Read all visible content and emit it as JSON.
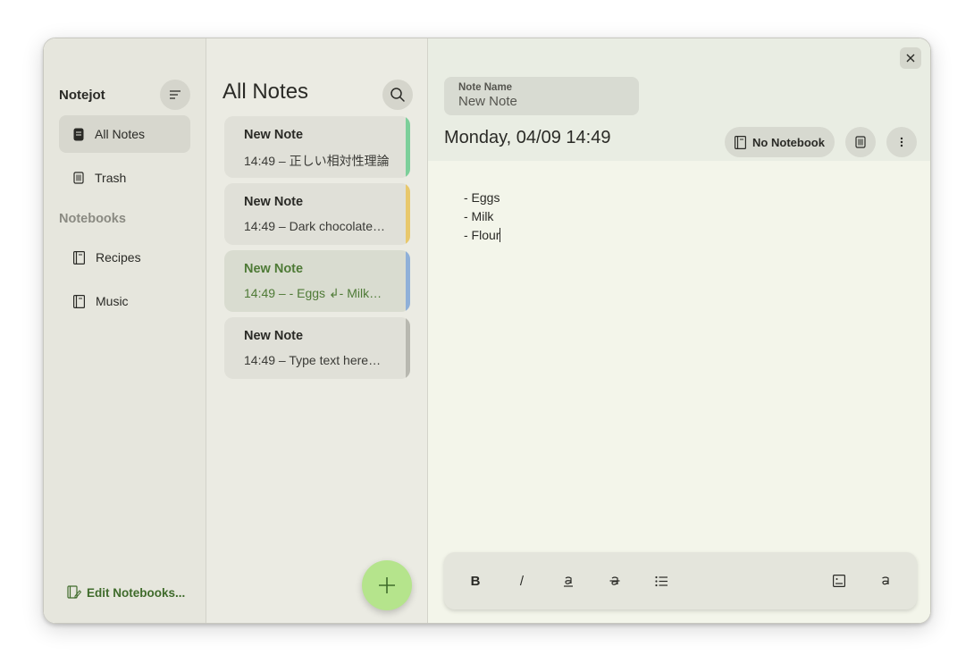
{
  "app": {
    "title": "Notejot"
  },
  "sidebar": {
    "items": [
      {
        "label": "All Notes",
        "icon": "note-icon"
      },
      {
        "label": "Trash",
        "icon": "trash-icon"
      }
    ],
    "notebooks_label": "Notebooks",
    "notebooks": [
      {
        "label": "Recipes",
        "icon": "notebook-icon"
      },
      {
        "label": "Music",
        "icon": "notebook-icon"
      }
    ],
    "edit_notebooks": "Edit Notebooks..."
  },
  "notes_list": {
    "title": "All Notes",
    "notes": [
      {
        "title": "New Note",
        "preview": "14:49 – 正しい相対性理論",
        "color": "#7ccf9a"
      },
      {
        "title": "New Note",
        "preview": "14:49 – Dark chocolate…",
        "color": "#e8c86c"
      },
      {
        "title": "New Note",
        "preview": "14:49 – - Eggs ↲- Milk…",
        "color": "#8fb0d8"
      },
      {
        "title": "New Note",
        "preview": "14:49 – Type text here…",
        "color": "#b8b8b0"
      }
    ]
  },
  "editor": {
    "name_label": "Note Name",
    "name_value": "New Note",
    "date": "Monday, 04/09 14:49",
    "notebook_button": "No Notebook",
    "lines": [
      "- Eggs",
      "- Milk",
      "- Flour"
    ]
  },
  "toolbar": {
    "bold": "B",
    "italic": "/"
  },
  "colors": {
    "accent": "#4e7a36",
    "fab": "#b5e48c"
  }
}
